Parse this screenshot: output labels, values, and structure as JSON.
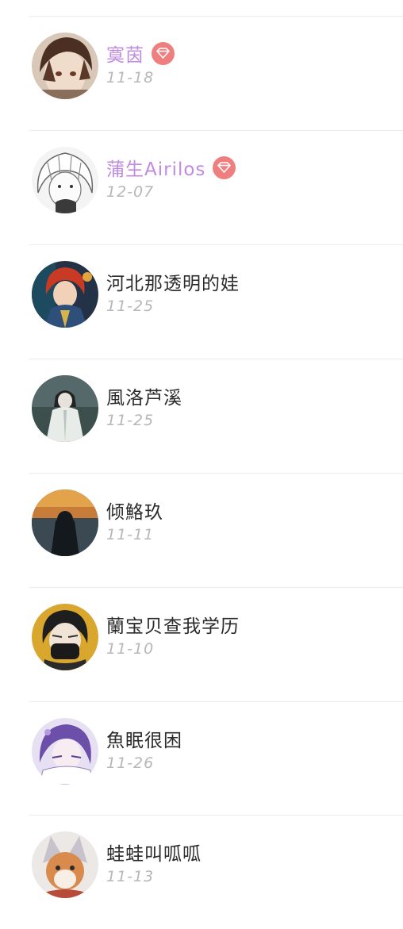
{
  "accent": {
    "vip_name": "#c08be0",
    "badge": "#ef7f7f",
    "date": "#b7b7b7"
  },
  "followers": [
    {
      "name": "寞茵",
      "date": "11-18",
      "vip": true,
      "avatar_icon": "brown-hair-anime-avatar-icon"
    },
    {
      "name": "蒲生Airilos",
      "date": "12-07",
      "vip": true,
      "avatar_icon": "white-hair-sketch-avatar-icon"
    },
    {
      "name": "河北那透明的娃",
      "date": "11-25",
      "vip": false,
      "avatar_icon": "red-hair-anime-avatar-icon"
    },
    {
      "name": "風洛芦溪",
      "date": "11-25",
      "vip": false,
      "avatar_icon": "white-robed-figure-avatar-icon"
    },
    {
      "name": "倾鮥玖",
      "date": "11-11",
      "vip": false,
      "avatar_icon": "sunset-silhouette-avatar-icon"
    },
    {
      "name": "蘭宝贝查我学历",
      "date": "11-10",
      "vip": false,
      "avatar_icon": "masked-figure-avatar-icon"
    },
    {
      "name": "魚眠很困",
      "date": "11-26",
      "vip": false,
      "avatar_icon": "purple-hair-anime-avatar-icon"
    },
    {
      "name": "蛙蛙叫呱呱",
      "date": "11-13",
      "vip": false,
      "avatar_icon": "fox-character-avatar-icon"
    }
  ]
}
